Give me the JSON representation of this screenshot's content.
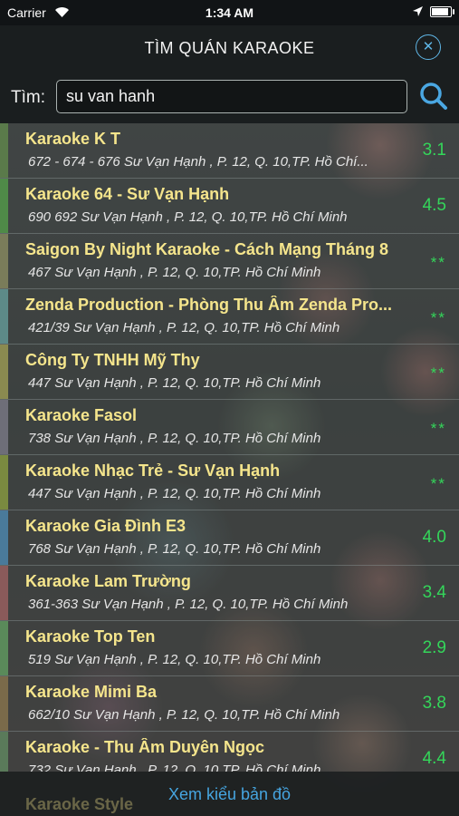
{
  "status": {
    "carrier": "Carrier",
    "time": "1:34 AM"
  },
  "nav": {
    "title": "TÌM QUÁN KARAOKE"
  },
  "search": {
    "label": "Tìm:",
    "value": "su van hanh"
  },
  "results": [
    {
      "name": "Karaoke K T",
      "address": "672 - 674 - 676 Sư Vạn Hạnh , P. 12, Q. 10,TP. Hồ Chí...",
      "rating": "3.1",
      "stripe": "#5a7a4a"
    },
    {
      "name": "Karaoke 64 - Sư Vạn Hạnh",
      "address": "690 692 Sư Vạn Hạnh , P. 12, Q. 10,TP. Hồ Chí Minh",
      "rating": "4.5",
      "stripe": "#4f8a48"
    },
    {
      "name": "Saigon By Night Karaoke - Cách Mạng Tháng 8",
      "address": "467 Sư Vạn Hạnh , P. 12, Q. 10,TP. Hồ Chí Minh",
      "rating": "**",
      "stripe": "#7a7c5a"
    },
    {
      "name": "Zenda Production - Phòng Thu Âm Zenda Pro...",
      "address": "421/39 Sư Vạn Hạnh , P. 12, Q. 10,TP. Hồ Chí Minh",
      "rating": "**",
      "stripe": "#5d8a88"
    },
    {
      "name": "Công Ty TNHH Mỹ Thy",
      "address": "447 Sư Vạn Hạnh , P. 12, Q. 10,TP. Hồ Chí Minh",
      "rating": "**",
      "stripe": "#8a8a50"
    },
    {
      "name": "Karaoke Fasol",
      "address": "738 Sư Vạn Hạnh , P. 12, Q. 10,TP. Hồ Chí Minh",
      "rating": "**",
      "stripe": "#6e6e78"
    },
    {
      "name": "Karaoke Nhạc Trẻ - Sư Vạn Hạnh",
      "address": "447 Sư Vạn Hạnh , P. 12, Q. 10,TP. Hồ Chí Minh",
      "rating": "**",
      "stripe": "#7a8a40"
    },
    {
      "name": "Karaoke Gia Đình E3",
      "address": "768 Sư Vạn Hạnh , P. 12, Q. 10,TP. Hồ Chí Minh",
      "rating": "4.0",
      "stripe": "#4a7a9a"
    },
    {
      "name": "Karaoke Lam Trường",
      "address": "361-363 Sư Vạn Hạnh , P. 12, Q. 10,TP. Hồ Chí Minh",
      "rating": "3.4",
      "stripe": "#8a5a5a"
    },
    {
      "name": "Karaoke Top Ten",
      "address": "519 Sư Vạn Hạnh , P. 12, Q. 10,TP. Hồ Chí Minh",
      "rating": "2.9",
      "stripe": "#5a8a5a"
    },
    {
      "name": "Karaoke Mimi Ba",
      "address": "662/10 Sư Vạn Hạnh , P. 12, Q. 10,TP. Hồ Chí Minh",
      "rating": "3.8",
      "stripe": "#7a6a4a"
    },
    {
      "name": "Karaoke - Thu Âm Duyên Ngọc",
      "address": "732 Sư Vạn Hạnh , P. 12, Q. 10,TP. Hồ Chí Minh",
      "rating": "4.4",
      "stripe": "#5a7a5a"
    }
  ],
  "peek_result": "Karaoke Style",
  "bottom": {
    "map_link": "Xem kiểu bản đồ"
  },
  "colors": {
    "name": "#f5e58c",
    "rating": "#34d65a",
    "accent": "#46a5e0"
  }
}
